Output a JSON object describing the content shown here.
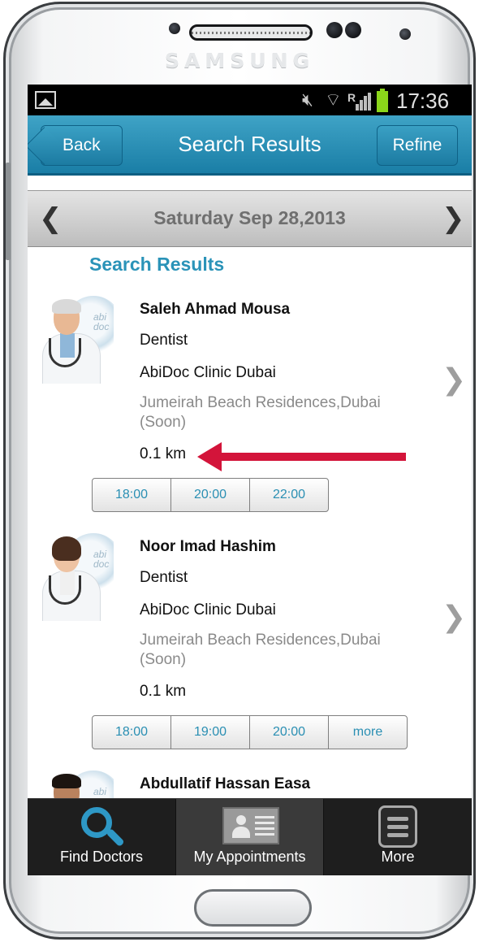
{
  "device": {
    "brand": "SAMSUNG"
  },
  "status_bar": {
    "time": "17:36",
    "network_label": "R"
  },
  "navbar": {
    "back_label": "Back",
    "title": "Search Results",
    "refine_label": "Refine"
  },
  "date_bar": {
    "date_label": "Saturday Sep 28,2013"
  },
  "results_section": {
    "title": "Search Results",
    "doctors": [
      {
        "name": "Saleh Ahmad Mousa",
        "specialty": "Dentist",
        "clinic": "AbiDoc Clinic Dubai",
        "address": "Jumeirah Beach Residences,Dubai (Soon)",
        "distance": "0.1 km",
        "avatar_logo": "abi doc",
        "slots": [
          "18:00",
          "20:00",
          "22:00"
        ]
      },
      {
        "name": "Noor Imad Hashim",
        "specialty": "Dentist",
        "clinic": "AbiDoc Clinic Dubai",
        "address": "Jumeirah Beach Residences,Dubai (Soon)",
        "distance": "0.1 km",
        "avatar_logo": "abi doc",
        "slots": [
          "18:00",
          "19:00",
          "20:00",
          "more"
        ]
      },
      {
        "name": "Abdullatif Hassan Easa",
        "avatar_logo": "abi"
      }
    ]
  },
  "tab_bar": {
    "items": [
      {
        "label": "Find Doctors",
        "icon": "search-icon"
      },
      {
        "label": "My Appointments",
        "icon": "contact-card-icon"
      },
      {
        "label": "More",
        "icon": "menu-icon"
      }
    ],
    "selected_index": 1
  },
  "colors": {
    "accent": "#2a93b8",
    "navbar": "#1a7ea6",
    "annotation_arrow": "#d3143a",
    "battery": "#8bd61a"
  }
}
